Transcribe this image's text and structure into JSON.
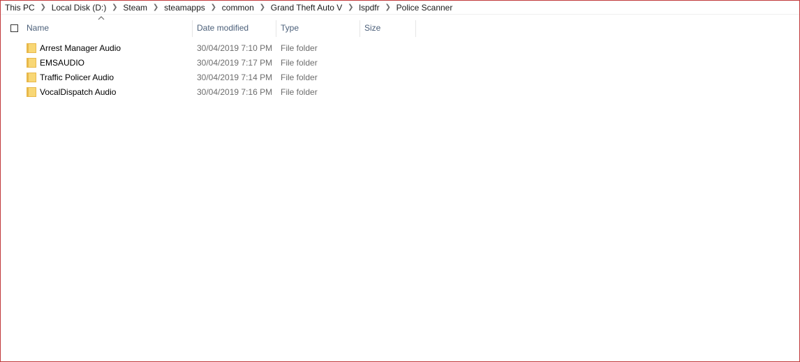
{
  "breadcrumb": [
    "This PC",
    "Local Disk (D:)",
    "Steam",
    "steamapps",
    "common",
    "Grand Theft Auto V",
    "lspdfr",
    "Police Scanner"
  ],
  "columns": {
    "name": "Name",
    "date": "Date modified",
    "type": "Type",
    "size": "Size"
  },
  "files": [
    {
      "name": "Arrest Manager Audio",
      "date": "30/04/2019 7:10 PM",
      "type": "File folder",
      "size": "",
      "icon": "folder-icon"
    },
    {
      "name": "EMSAUDIO",
      "date": "30/04/2019 7:17 PM",
      "type": "File folder",
      "size": "",
      "icon": "folder-icon"
    },
    {
      "name": "Traffic Policer Audio",
      "date": "30/04/2019 7:14 PM",
      "type": "File folder",
      "size": "",
      "icon": "folder-icon"
    },
    {
      "name": "VocalDispatch Audio",
      "date": "30/04/2019 7:16 PM",
      "type": "File folder",
      "size": "",
      "icon": "folder-icon"
    }
  ],
  "colors": {
    "header_text": "#4c607a",
    "folder": "#f8d775",
    "window_border": "#c0393b"
  }
}
